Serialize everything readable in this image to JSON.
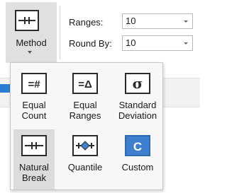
{
  "ribbon": {
    "method_button": {
      "label": "Method",
      "icon": "natural-break-icon"
    },
    "ranges": {
      "label": "Ranges:",
      "value": "10"
    },
    "round_by": {
      "label": "Round By:",
      "value": "10"
    }
  },
  "dropdown": {
    "options": [
      {
        "label": "Equal\nCount",
        "icon": "equal-count-icon",
        "glyph": "=#"
      },
      {
        "label": "Equal\nRanges",
        "icon": "equal-ranges-icon",
        "glyph": "=Δ"
      },
      {
        "label": "Standard\nDeviation",
        "icon": "standard-deviation-icon",
        "glyph": "σ"
      },
      {
        "label": "Natural\nBreak",
        "icon": "natural-break-icon",
        "glyph": ""
      },
      {
        "label": "Quantile",
        "icon": "quantile-icon",
        "glyph": ""
      },
      {
        "label": "Custom",
        "icon": "custom-icon",
        "glyph": "C"
      }
    ],
    "selected_index": 3
  },
  "colors": {
    "icon_border": "#2b2b2b",
    "icon_fill": "#ffffff",
    "accent_blue": "#3f7fcf",
    "selected_bg": "#dcdcdc"
  }
}
